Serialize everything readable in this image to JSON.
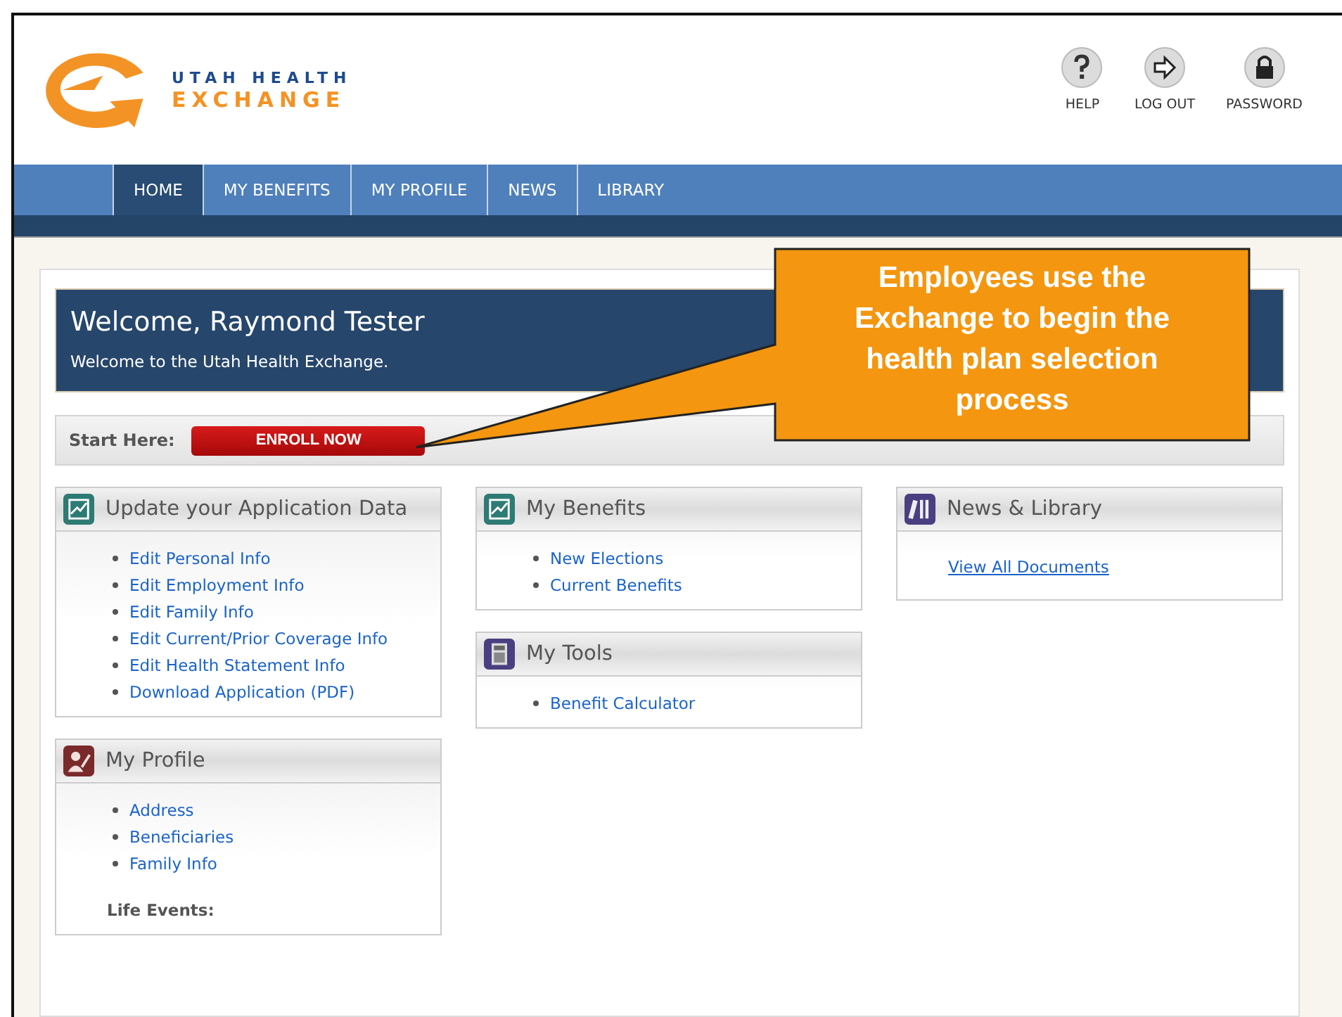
{
  "logo": {
    "line_1": "UTAH HEALTH",
    "line_2": "EXCHANGE"
  },
  "header_buttons": [
    {
      "kind": "help",
      "label": "HELP"
    },
    {
      "kind": "logout",
      "label": "LOG OUT"
    },
    {
      "kind": "password",
      "label": "PASSWORD"
    }
  ],
  "tabs": [
    {
      "label": "HOME",
      "selected": true
    },
    {
      "label": "MY BENEFITS",
      "selected": false
    },
    {
      "label": "MY PROFILE",
      "selected": false
    },
    {
      "label": "NEWS",
      "selected": false
    },
    {
      "label": "LIBRARY",
      "selected": false
    }
  ],
  "welcome": {
    "title": "Welcome, Raymond Tester",
    "subtitle": "Welcome to the Utah Health Exchange."
  },
  "start": {
    "label": "Start Here:",
    "button": "ENROLL NOW"
  },
  "columns": [
    [
      {
        "title": "Update your Application Data",
        "kind": "chart",
        "items": [
          {
            "kind": "bullet",
            "text": "Edit Personal Info"
          },
          {
            "kind": "bullet",
            "text": "Edit Employment Info"
          },
          {
            "kind": "bullet",
            "text": "Edit Family Info"
          },
          {
            "kind": "bullet",
            "text": "Edit Current/Prior Coverage Info"
          },
          {
            "kind": "bullet",
            "text": "Edit Health Statement Info"
          },
          {
            "kind": "bullet",
            "text": "Download Application (PDF)"
          }
        ]
      },
      {
        "title": "My Profile",
        "kind": "person",
        "items": [
          {
            "kind": "bullet",
            "text": "Address"
          },
          {
            "kind": "bullet",
            "text": "Beneficiaries"
          },
          {
            "kind": "bullet",
            "text": "Family Info"
          },
          {
            "kind": "label",
            "text": "Life Events:"
          }
        ]
      }
    ],
    [
      {
        "title": "My Benefits",
        "kind": "chart",
        "items": [
          {
            "kind": "bullet",
            "text": "New Elections"
          },
          {
            "kind": "bullet",
            "text": "Current Benefits"
          }
        ]
      },
      {
        "title": "My Tools",
        "kind": "calculator",
        "items": [
          {
            "kind": "bullet",
            "text": "Benefit Calculator"
          }
        ]
      }
    ],
    [
      {
        "title": "News & Library",
        "kind": "books",
        "items": [
          {
            "kind": "link",
            "text": "View All Documents"
          }
        ]
      }
    ]
  ],
  "callout": {
    "text": "Employees use the Exchange to begin the health plan selection process"
  }
}
